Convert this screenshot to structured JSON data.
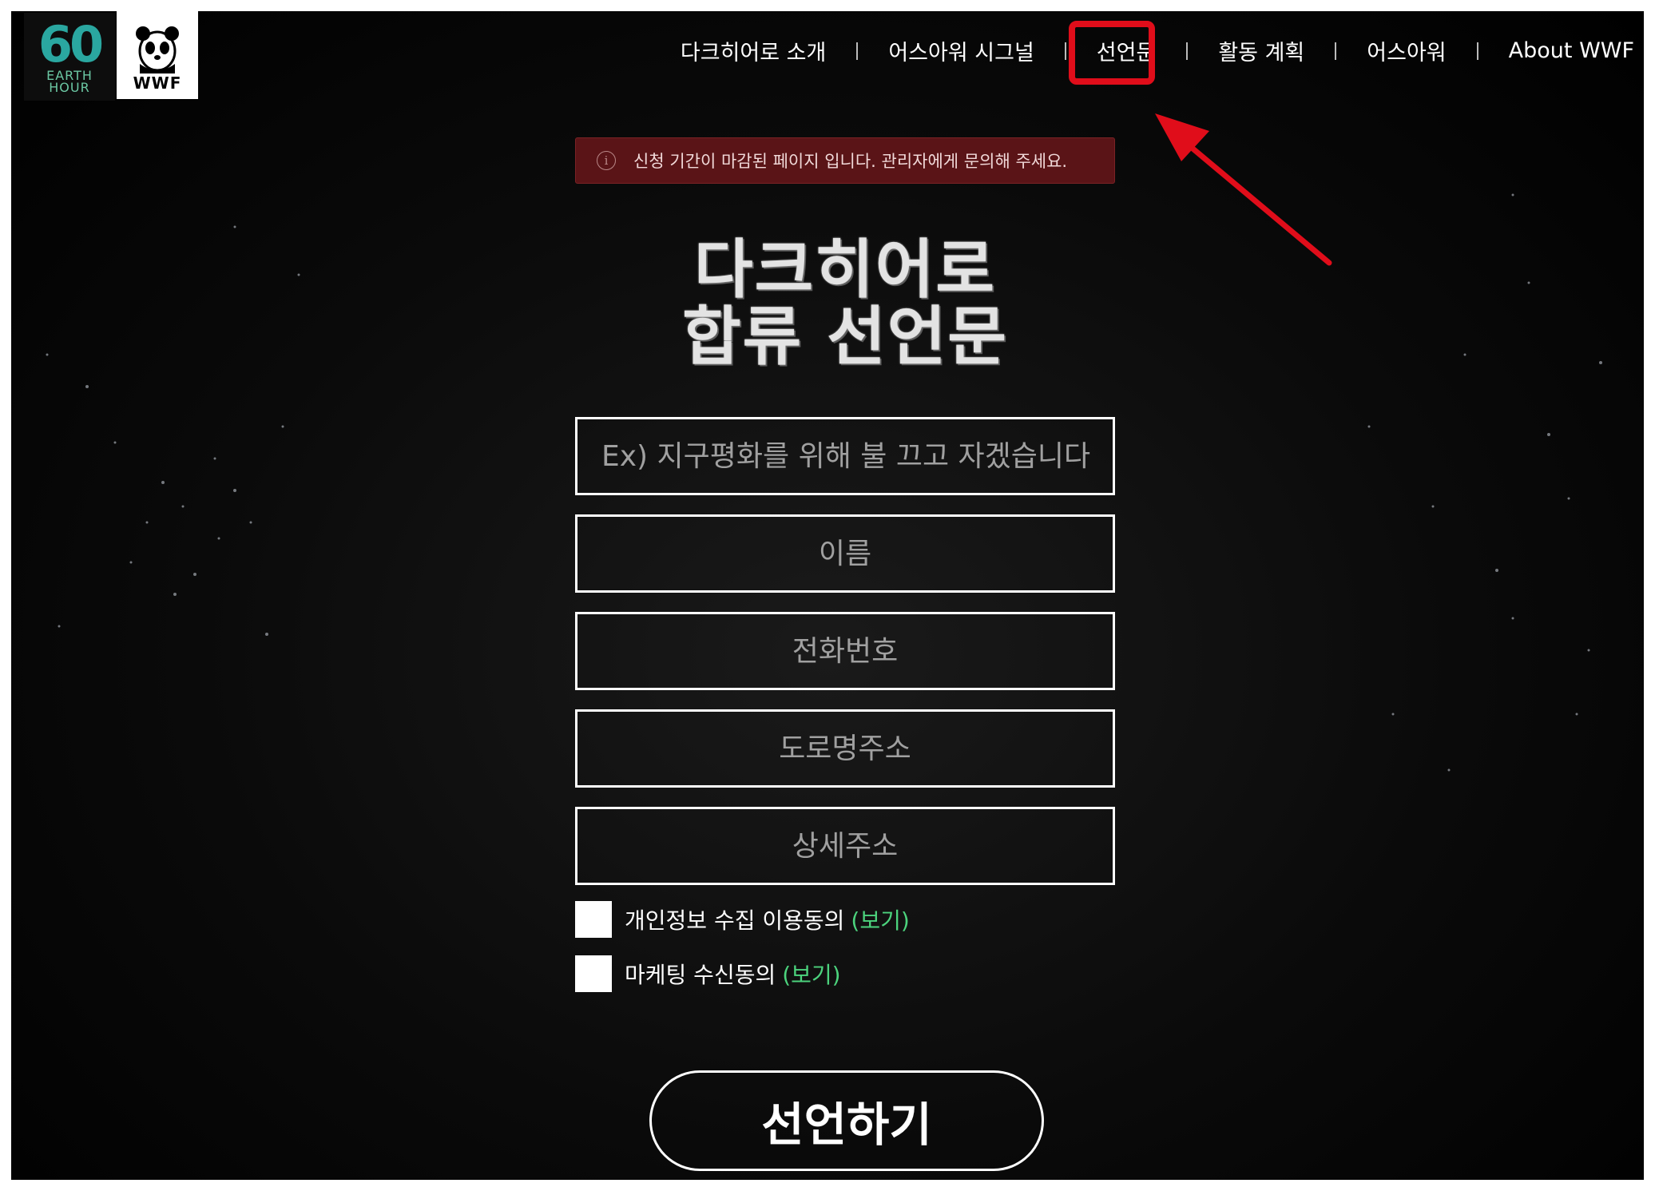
{
  "header": {
    "earth_hour_logo": {
      "number": "60",
      "line1": "EARTH",
      "line2": "HOUR"
    },
    "wwf_logo": {
      "text": "WWF"
    },
    "nav": [
      {
        "label": "다크히어로 소개"
      },
      {
        "label": "어스아워 시그널"
      },
      {
        "label": "선언문"
      },
      {
        "label": "활동 계획"
      },
      {
        "label": "어스아워"
      },
      {
        "label": "About WWF"
      }
    ]
  },
  "alert": {
    "icon": "info-icon",
    "message": "신청 기간이 마감된 페이지 입니다. 관리자에게 문의해 주세요."
  },
  "title": {
    "line1": "다크히어로",
    "line2": "합류 선언문"
  },
  "form": {
    "declaration_placeholder": "Ex) 지구평화를 위해 불 끄고 자겠습니다",
    "name_placeholder": "이름",
    "phone_placeholder": "전화번호",
    "road_address_placeholder": "도로명주소",
    "detail_address_placeholder": "상세주소",
    "privacy_consent": {
      "label": "개인정보 수집 이용동의",
      "view": "(보기)"
    },
    "marketing_consent": {
      "label": "마케팅 수신동의",
      "view": "(보기)"
    },
    "submit_label": "선언하기"
  },
  "annotation": {
    "highlight_color": "#e00d1a",
    "highlighted_item": "선언문"
  },
  "colors": {
    "background": "#000000",
    "alert_bg": "#5a1417",
    "link_green": "#4cd37d",
    "earth_hour_teal": "#2aa7a0"
  }
}
